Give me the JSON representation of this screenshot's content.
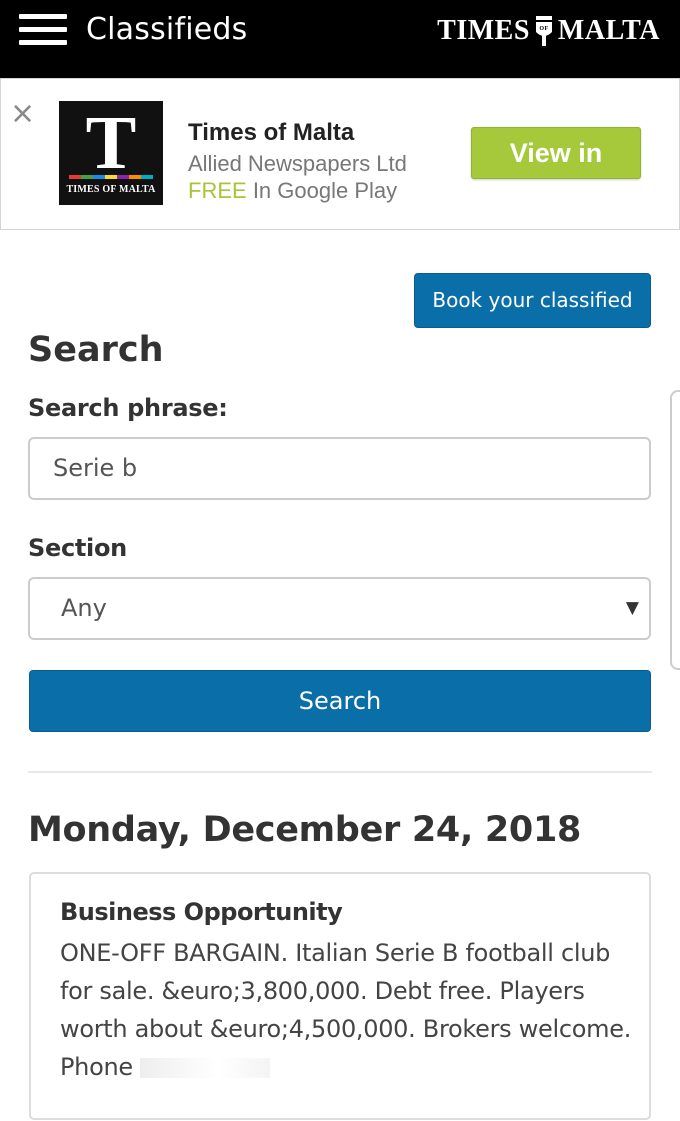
{
  "header": {
    "title": "Classifieds",
    "brand_left": "TIMES",
    "brand_right": "MALTA",
    "menu_icon": "hamburger-menu-icon"
  },
  "app_banner": {
    "close_glyph": "×",
    "icon_letter": "T",
    "icon_caption": "TIMES OF MALTA",
    "app_name": "Times of Malta",
    "company": "Allied Newspapers Ltd",
    "price_free": "FREE",
    "price_store": "In Google Play",
    "cta_label": "View in Store",
    "colors": {
      "cta": "#a5c93a",
      "free": "#a8c439"
    },
    "icon_strip_colors": [
      "#e53935",
      "#43a047",
      "#1e88e5",
      "#fdd835",
      "#8e24aa",
      "#fb8c00",
      "#00acc1"
    ]
  },
  "actions": {
    "book_label": "Book your classified"
  },
  "search": {
    "heading": "Search",
    "phrase_label": "Search phrase:",
    "phrase_value": "Serie b",
    "section_label": "Section",
    "section_value": "Any",
    "caret": "▼",
    "button_label": "Search"
  },
  "results": {
    "date": "Monday, December 24, 2018",
    "listing": {
      "category": "Business Opportunity",
      "text": "ONE-OFF BARGAIN. Italian Serie B football club for sale. &euro;3,800,000. Debt free. Players worth about &euro;4,500,000. Brokers welcome. Phone"
    }
  },
  "colors": {
    "primary": "#0a6ea8",
    "header_bg": "#000000"
  }
}
